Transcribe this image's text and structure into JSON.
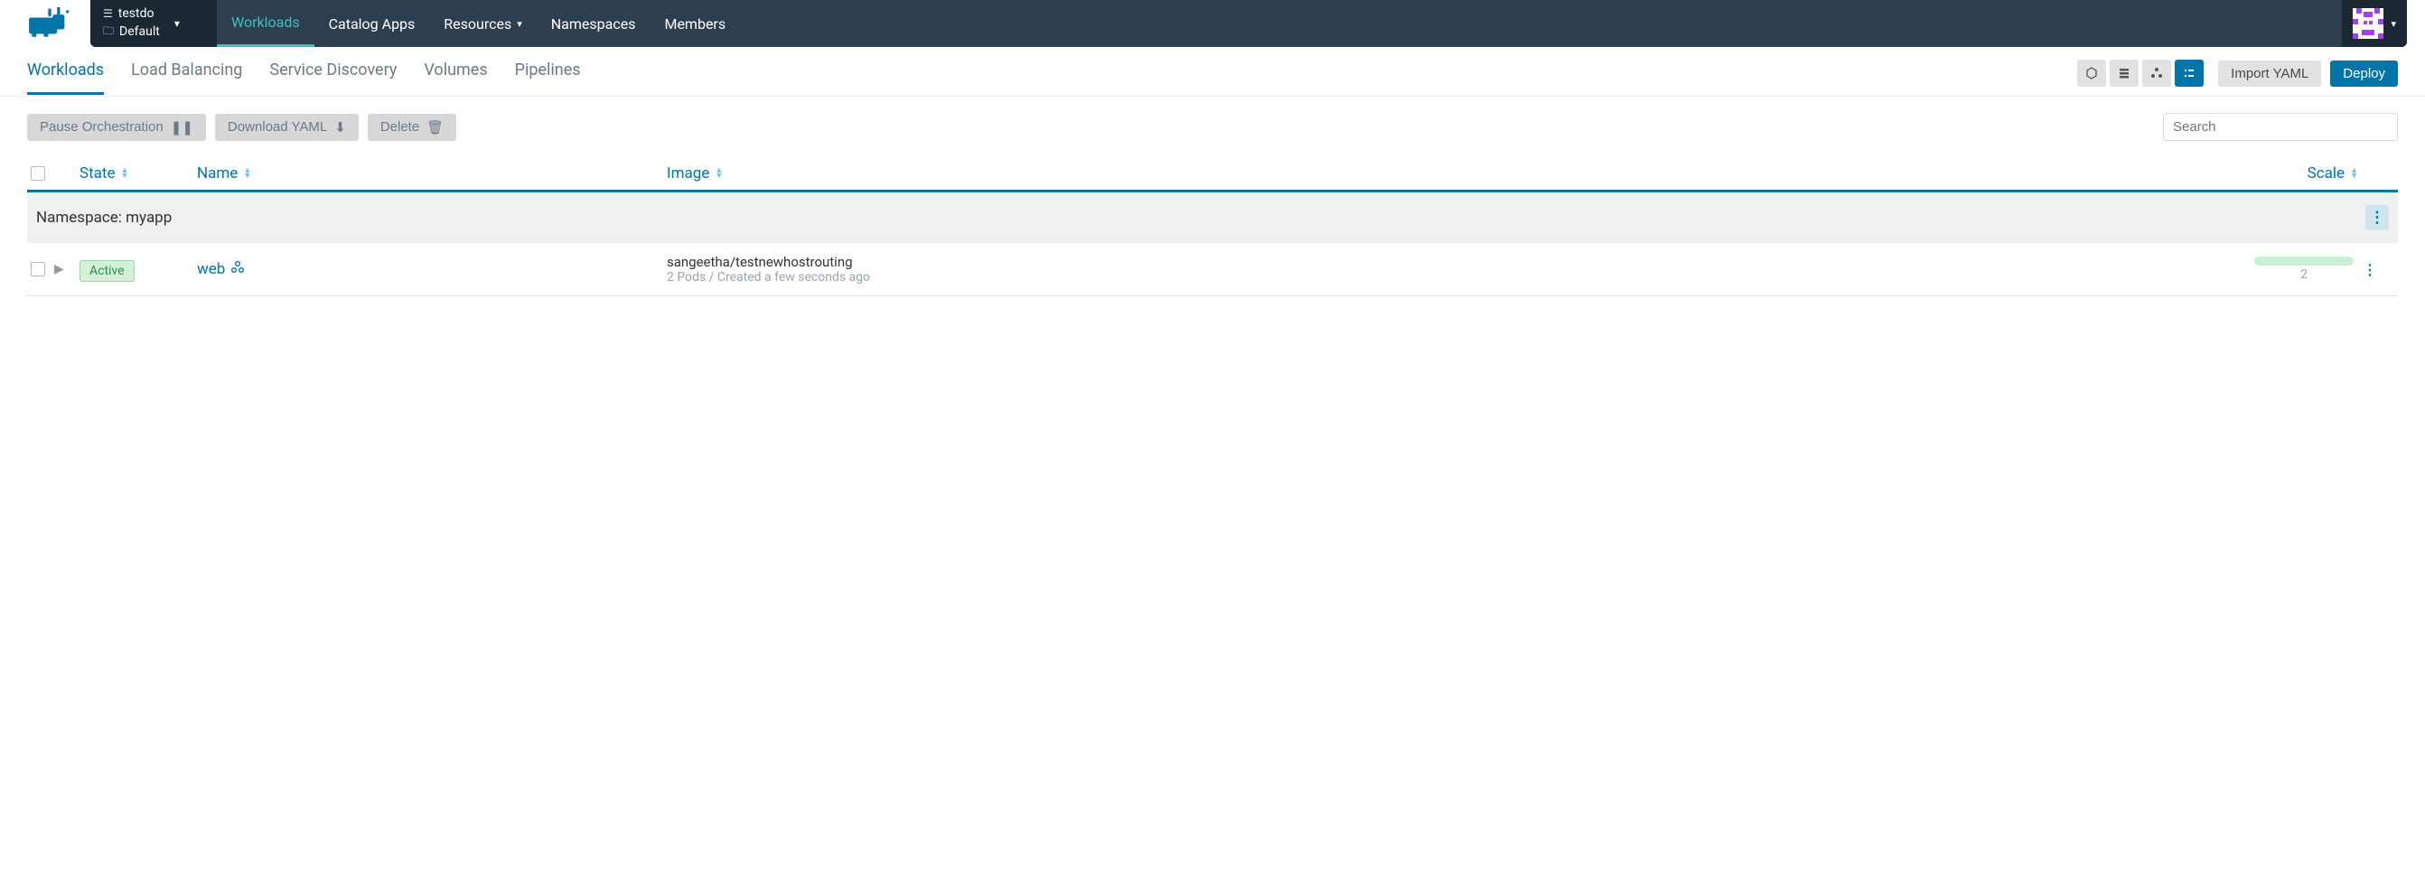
{
  "cluster": {
    "name": "testdo",
    "project": "Default"
  },
  "nav": {
    "workloads": "Workloads",
    "catalog": "Catalog Apps",
    "resources": "Resources",
    "namespaces": "Namespaces",
    "members": "Members"
  },
  "subtabs": {
    "workloads": "Workloads",
    "lb": "Load Balancing",
    "sd": "Service Discovery",
    "volumes": "Volumes",
    "pipelines": "Pipelines"
  },
  "actions": {
    "import_yaml": "Import YAML",
    "deploy": "Deploy",
    "pause": "Pause Orchestration",
    "download": "Download YAML",
    "delete": "Delete"
  },
  "search_placeholder": "Search",
  "thead": {
    "state": "State",
    "name": "Name",
    "image": "Image",
    "scale": "Scale"
  },
  "namespace_label": "Namespace: myapp",
  "row": {
    "state": "Active",
    "name": "web",
    "image": "sangeetha/testnewhostrouting",
    "sub": "2 Pods / Created a few seconds ago",
    "scale": "2"
  }
}
